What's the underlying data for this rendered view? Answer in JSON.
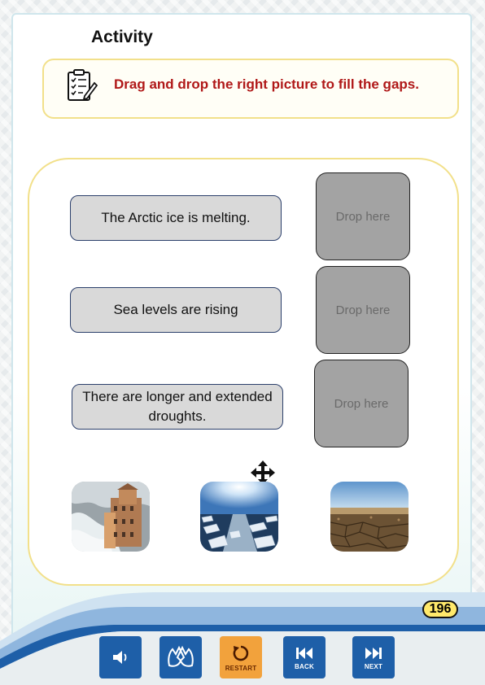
{
  "activity": {
    "title": "Activity",
    "instruction": "Drag and drop the right picture to fill the gaps.",
    "instruction_icon": "checklist-pencil-icon"
  },
  "statements": [
    {
      "text": "The Arctic ice is melting."
    },
    {
      "text": "Sea levels are rising"
    },
    {
      "text": "There are longer and extended droughts."
    }
  ],
  "drop_zones": [
    {
      "label": "Drop here"
    },
    {
      "label": "Drop here"
    },
    {
      "label": "Drop here"
    }
  ],
  "pictures": [
    {
      "name": "flooded-coastal-town-picture"
    },
    {
      "name": "melting-sea-ice-picture"
    },
    {
      "name": "dry-cracked-field-picture"
    }
  ],
  "move_icon": "move-arrows-icon",
  "page_number": "196",
  "toolbar": {
    "audio_icon": "speaker-icon",
    "sign_icon": "sign-language-icon",
    "restart_label": "RESTART",
    "back_label": "BACK",
    "next_label": "NEXT"
  },
  "colors": {
    "instruction_text": "#b01818",
    "panel_border": "#f2e08a",
    "button_blue": "#1e5fa8",
    "button_orange": "#f2a23c",
    "footer_wave": "#1e5fa8",
    "page_badge": "#ffe96b"
  }
}
